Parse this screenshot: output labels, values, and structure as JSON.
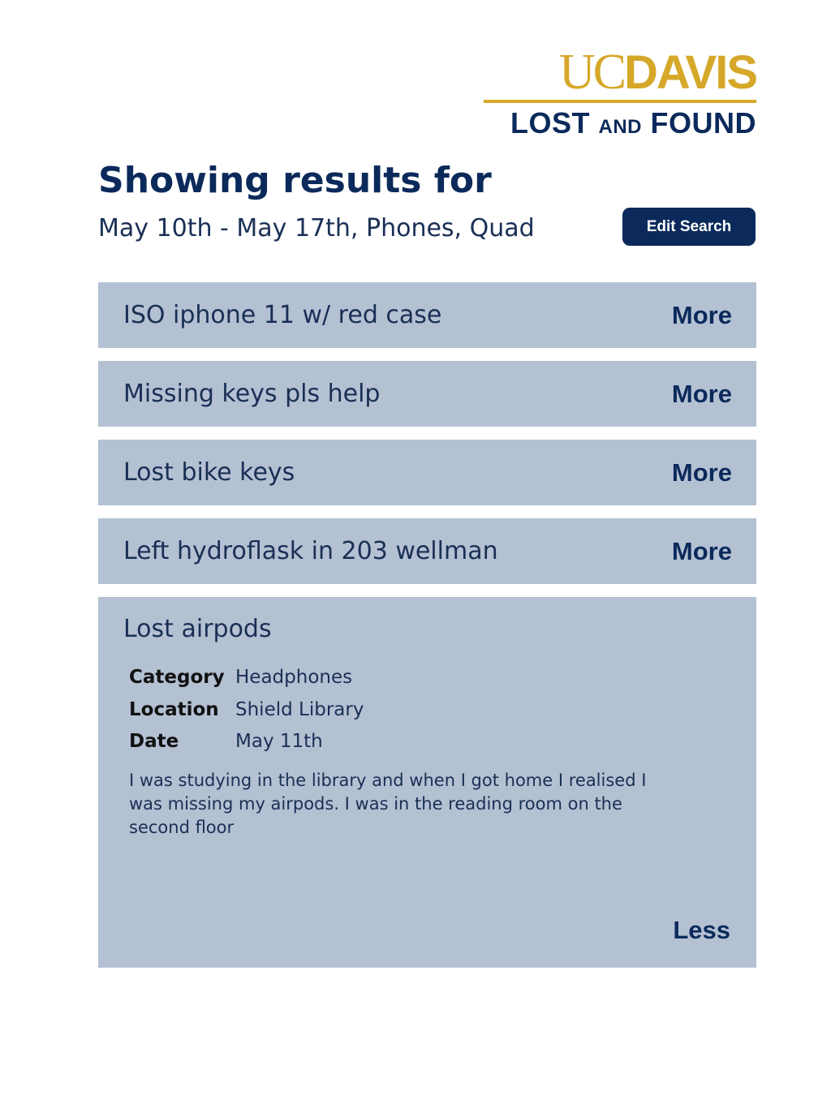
{
  "logo": {
    "uc": "UC",
    "davis": "DAVIS",
    "lost": "LOST",
    "and": "AND",
    "found": "FOUND",
    "color_gold": "#d6a829",
    "color_navy": "#0b2a5b"
  },
  "header": {
    "title": "Showing results for",
    "filters": "May 10th - May 17th, Phones, Quad",
    "edit_button": "Edit Search"
  },
  "results": [
    {
      "title": "ISO iphone 11 w/ red case",
      "action": "More"
    },
    {
      "title": "Missing keys pls help",
      "action": "More"
    },
    {
      "title": "Lost bike keys",
      "action": "More"
    },
    {
      "title": "Left hydroflask in 203 wellman",
      "action": "More"
    }
  ],
  "expanded_result": {
    "title": "Lost airpods",
    "fields": [
      {
        "key": "Category",
        "value": "Headphones"
      },
      {
        "key": "Location",
        "value": "Shield Library"
      },
      {
        "key": "Date",
        "value": "May 11th"
      }
    ],
    "description": "I was studying in the library and when I got home I realised I was missing my airpods. I was in the reading room on the second floor",
    "action": "Less"
  },
  "colors": {
    "card_background": "#b4c1d3",
    "button_background": "#0b2a5b",
    "text": "#1a2f55"
  }
}
